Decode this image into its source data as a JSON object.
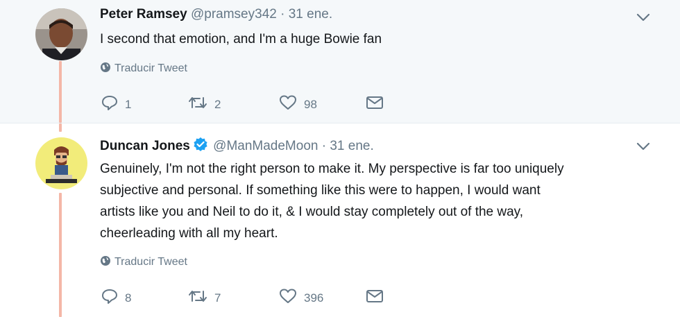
{
  "tweets": [
    {
      "name": "Peter Ramsey",
      "handle": "@pramsey342",
      "separator": "·",
      "time": "31 ene.",
      "text": "I second that emotion, and I'm a huge Bowie fan",
      "translate_label": "Traducir Tweet",
      "replies": "1",
      "retweets": "2",
      "likes": "98",
      "verified": false
    },
    {
      "name": "Duncan Jones",
      "handle": "@ManMadeMoon",
      "separator": "·",
      "time": "31 ene.",
      "text": "Genuinely, I'm not the right person to make it.  My perspective is far too uniquely\nsubjective and personal.  If something like this were to happen, I would want\nartists like you and Neil to do it, & I would stay completely out of the way,\ncheerleading with all my heart.",
      "translate_label": "Traducir Tweet",
      "replies": "8",
      "retweets": "7",
      "likes": "396",
      "verified": true
    }
  ],
  "colors": {
    "thread_line": "#f4b7a7",
    "verified_blue": "#1da1f2",
    "muted": "#657786",
    "highlight_bg": "#f5f8fa"
  },
  "icons": [
    "reply-icon",
    "retweet-icon",
    "like-icon",
    "direct-message-icon",
    "globe-icon",
    "chevron-down-icon",
    "verified-badge-icon"
  ]
}
